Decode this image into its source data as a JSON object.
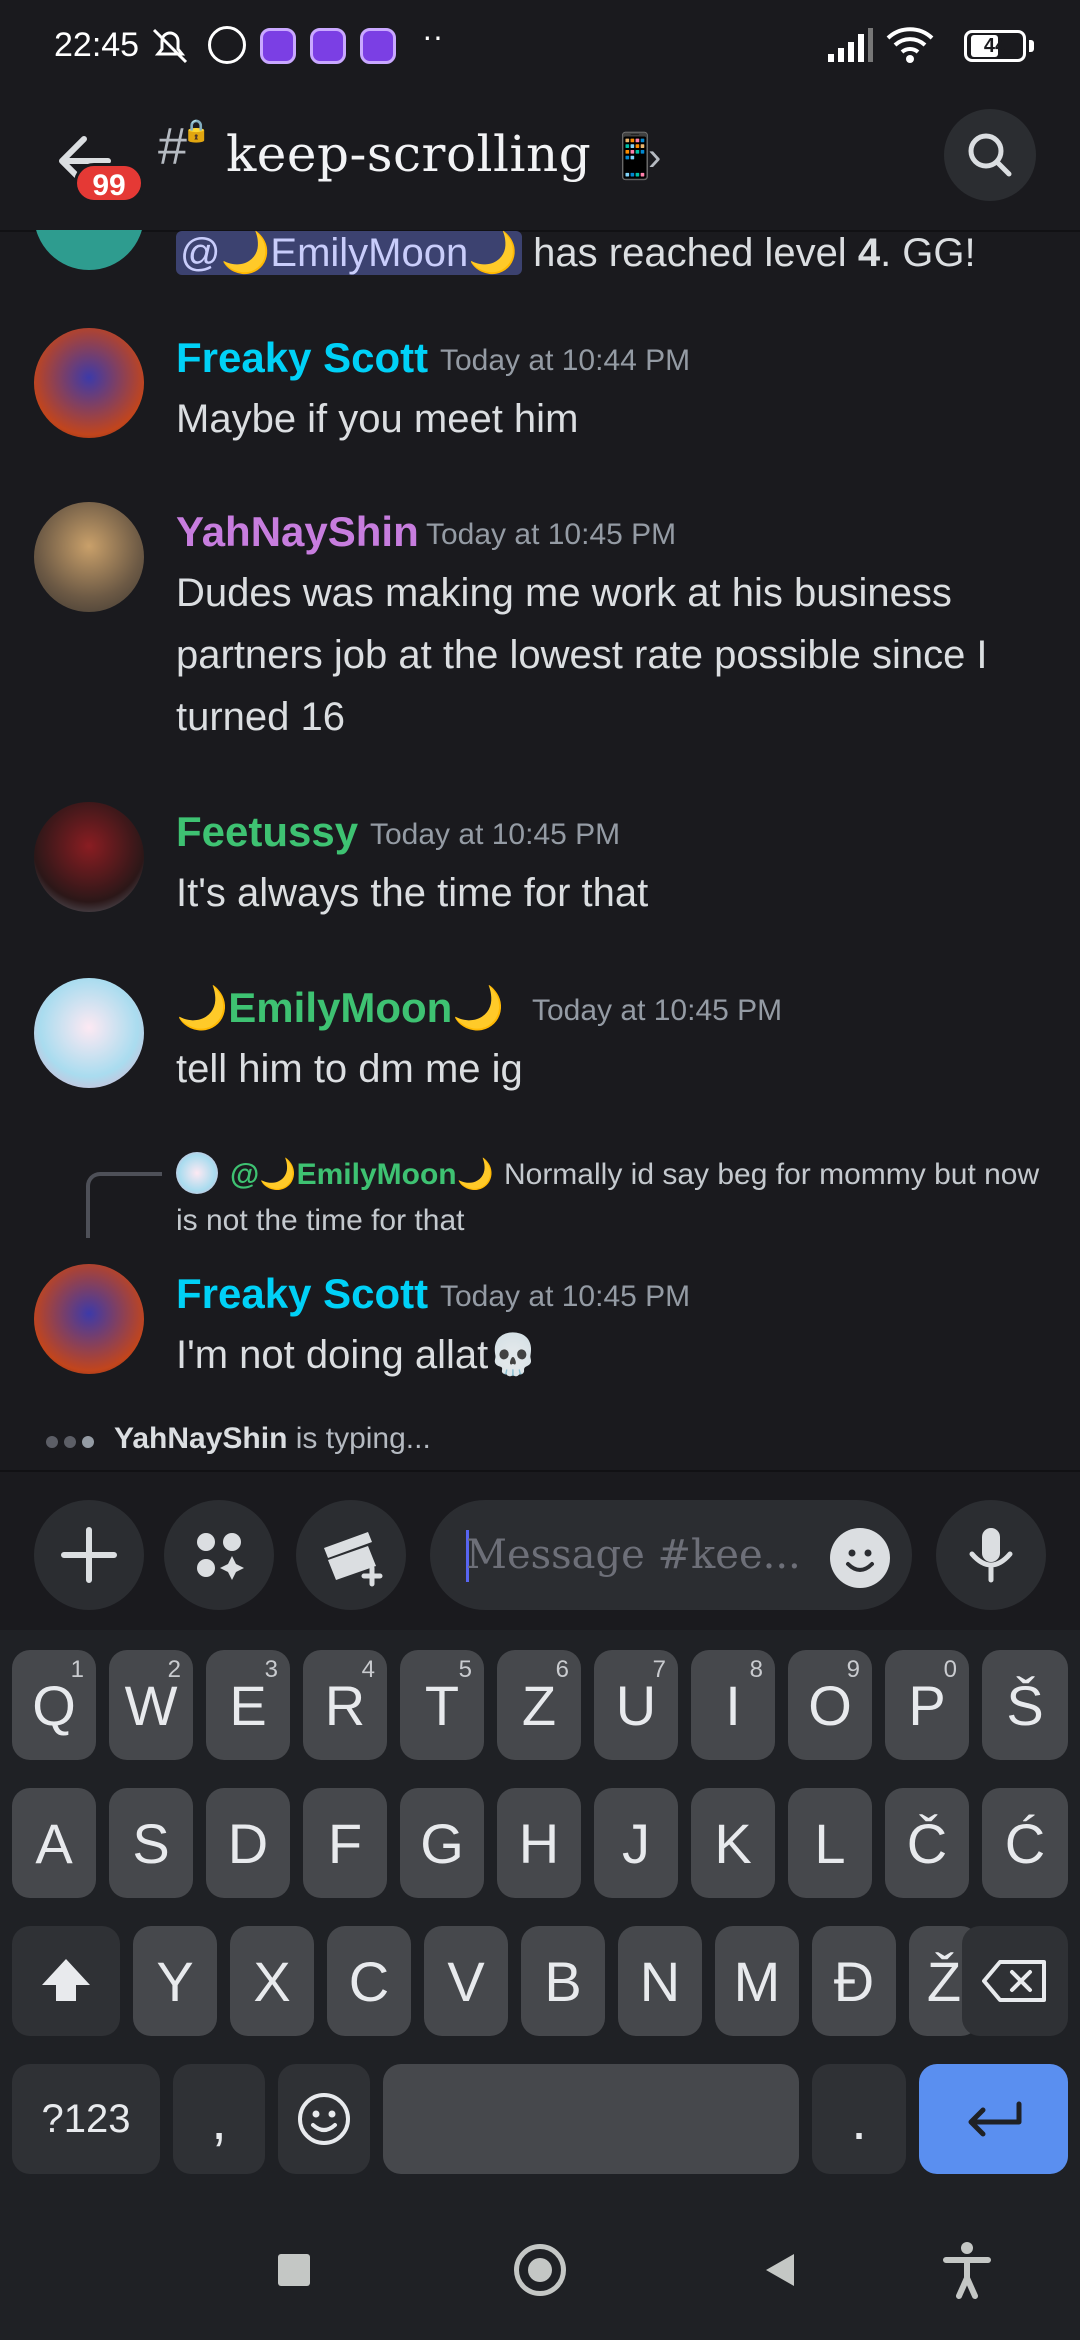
{
  "status_bar": {
    "time": "22:45",
    "battery": "44"
  },
  "header": {
    "channel_name": "keep-scrolling",
    "channel_emoji": "📱",
    "unread_count": "99"
  },
  "messages": {
    "levelup": {
      "mention": "@🌙EmilyMoon🌙",
      "text_before_level": " has reached level ",
      "level": "4",
      "text_after": ". GG!"
    },
    "m1": {
      "author": "Freaky Scott",
      "time": "Today at 10:44 PM",
      "text": "Maybe if you meet him",
      "color": "#00d1f7"
    },
    "m2": {
      "author": "YahNayShin",
      "time": "Today at 10:45 PM",
      "text": "Dudes was making me work at his business partners job at the lowest rate possible since I turned 16",
      "color": "#c77dde"
    },
    "m3": {
      "author": "Feetussy",
      "time": "Today at 10:45 PM",
      "text": "It's always the time for that",
      "color": "#3ec272"
    },
    "m4": {
      "author": "🌙EmilyMoon🌙",
      "time": "Today at 10:45 PM",
      "text": "tell him to dm me ig",
      "color": "#3ec272"
    },
    "m5": {
      "reply_mention": "@🌙EmilyMoon🌙",
      "reply_text": "Normally id say beg for mommy but now is not the time for that",
      "author": "Freaky Scott",
      "time": "Today at 10:45 PM",
      "text": "I'm not doing allat💀",
      "color": "#00d1f7"
    }
  },
  "typing": {
    "user": "YahNayShin",
    "text": " is typing..."
  },
  "composer": {
    "placeholder": "Message #kee..."
  },
  "keyboard": {
    "row1": [
      {
        "k": "Q",
        "h": "1"
      },
      {
        "k": "W",
        "h": "2"
      },
      {
        "k": "E",
        "h": "3"
      },
      {
        "k": "R",
        "h": "4"
      },
      {
        "k": "T",
        "h": "5"
      },
      {
        "k": "Z",
        "h": "6"
      },
      {
        "k": "U",
        "h": "7"
      },
      {
        "k": "I",
        "h": "8"
      },
      {
        "k": "O",
        "h": "9"
      },
      {
        "k": "P",
        "h": "0"
      },
      {
        "k": "Š",
        "h": ""
      }
    ],
    "row2": [
      "A",
      "S",
      "D",
      "F",
      "G",
      "H",
      "J",
      "K",
      "L",
      "Č",
      "Ć"
    ],
    "row3": [
      "Y",
      "X",
      "C",
      "V",
      "B",
      "N",
      "M",
      "Đ",
      "Ž"
    ],
    "sym_label": "?123",
    "comma": ",",
    "period": "."
  }
}
